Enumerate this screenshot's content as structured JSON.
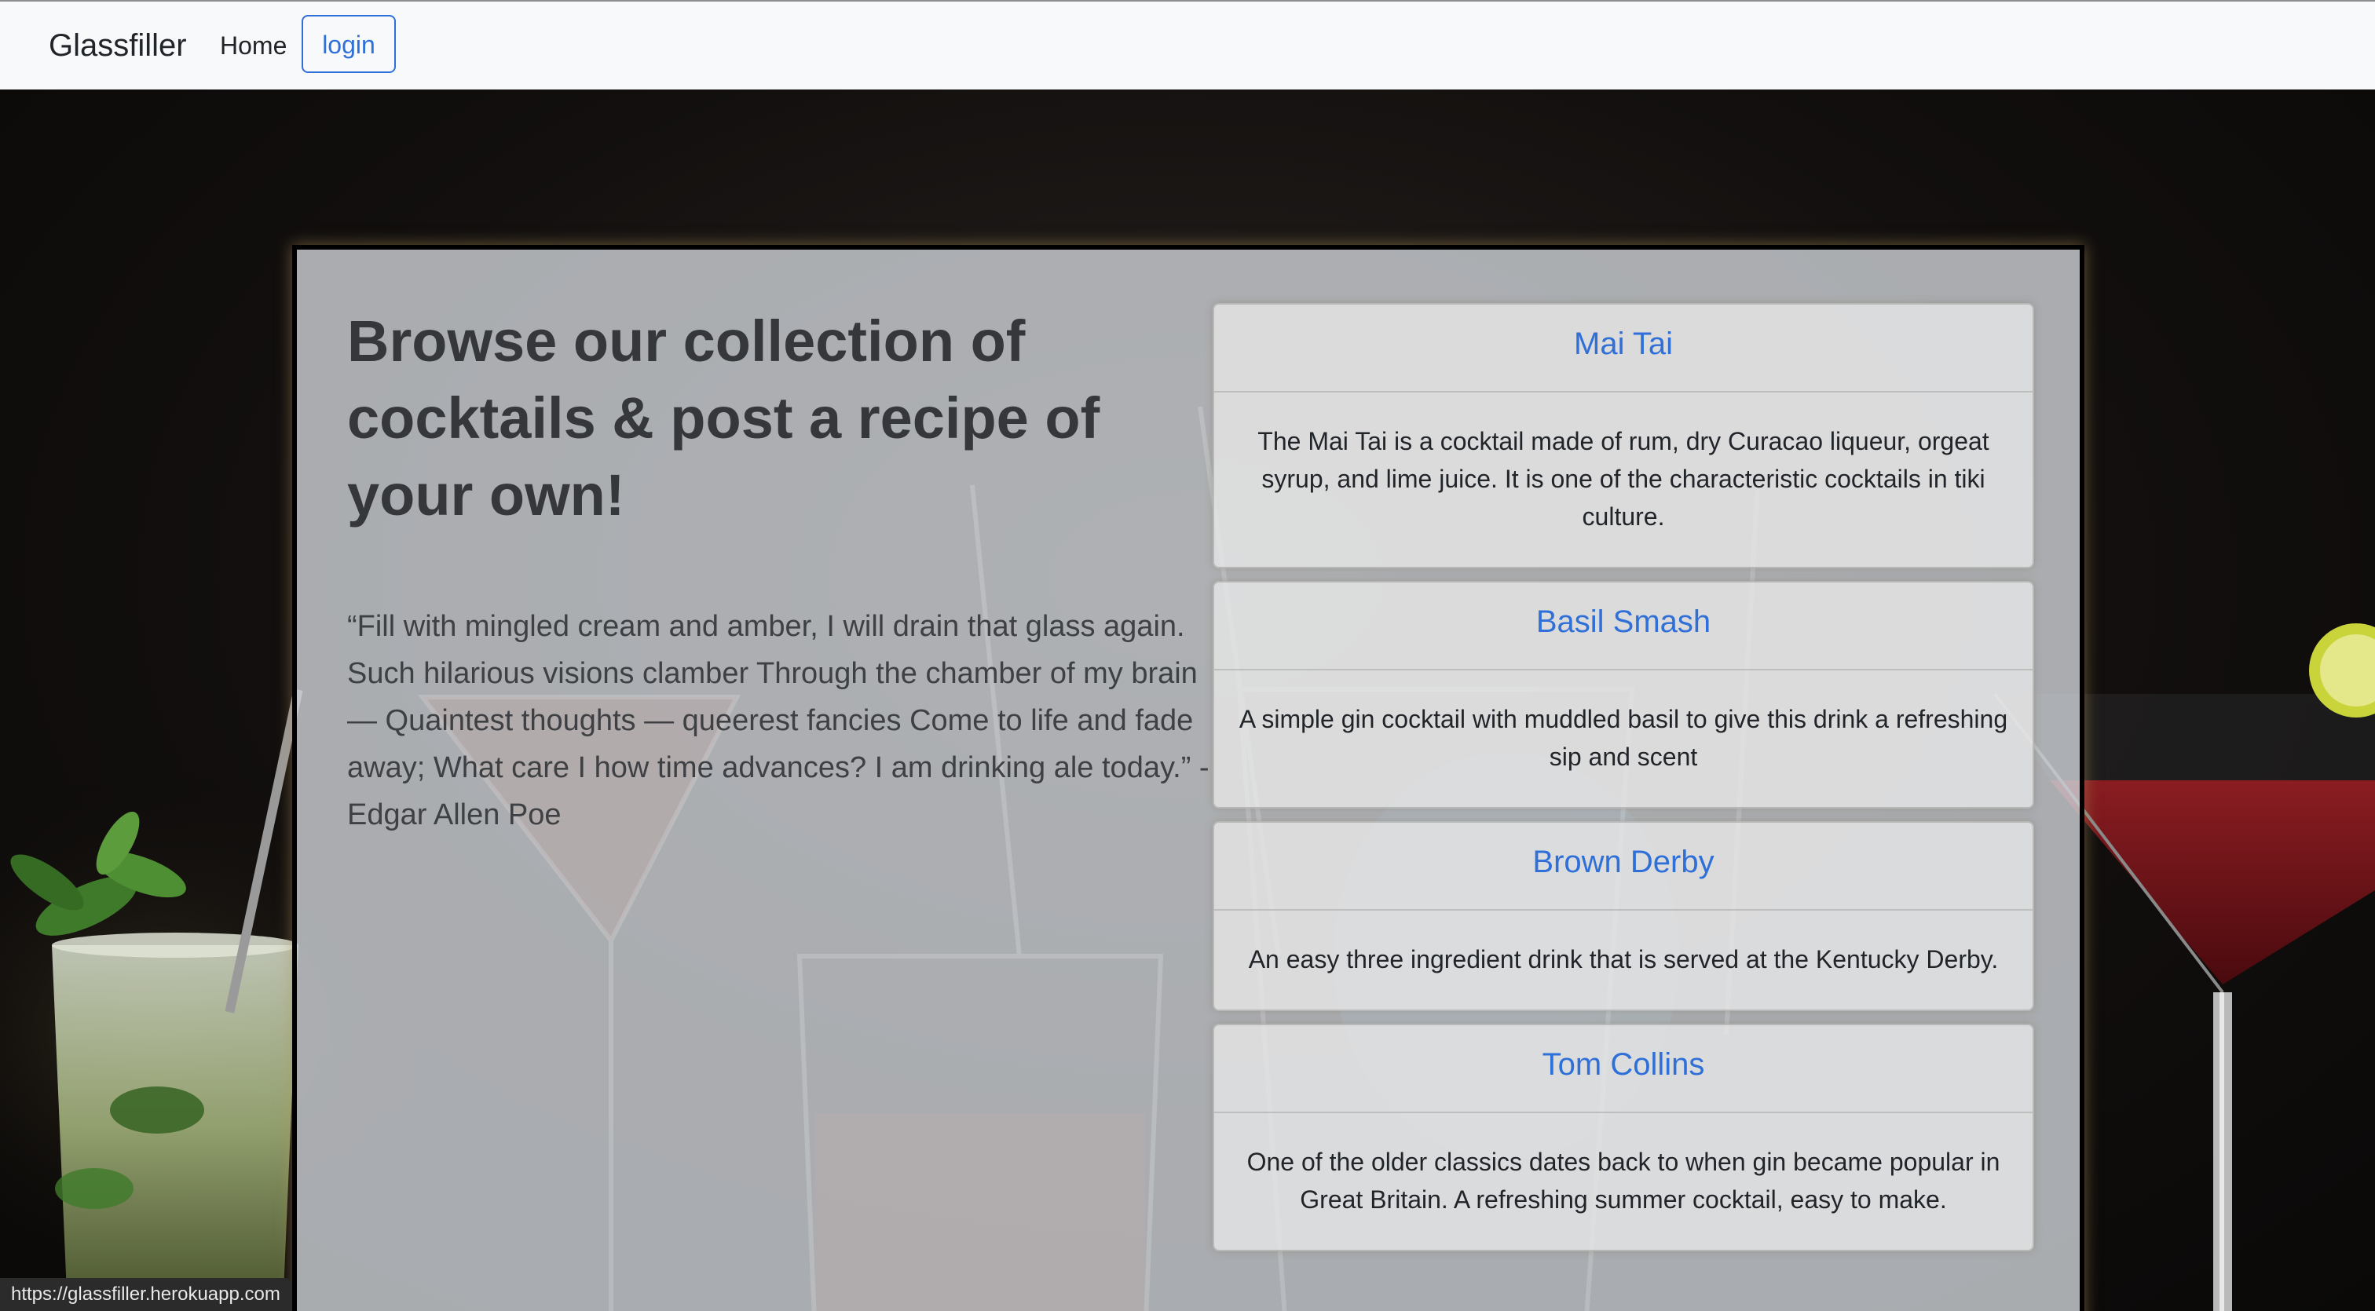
{
  "navbar": {
    "brand": "Glassfiller",
    "home_label": "Home",
    "login_label": "login"
  },
  "hero": {
    "headline": "Browse our collection of cocktails & post a recipe of your own!",
    "quote": "“Fill with mingled cream and amber, I will drain that glass again. Such hilarious visions clamber Through the chamber of my brain — Quaintest thoughts — queerest fancies Come to life and fade away; What care I how time advances? I am drinking ale today.” -Edgar Allen Poe"
  },
  "cocktails": [
    {
      "name": "Mai Tai",
      "description": "The Mai Tai is a cocktail made of rum, dry Curacao liqueur, orgeat syrup, and lime juice. It is one of the characteristic cocktails in tiki culture."
    },
    {
      "name": "Basil Smash",
      "description": "A simple gin cocktail with muddled basil to give this drink a refreshing sip and scent"
    },
    {
      "name": "Brown Derby",
      "description": "An easy three ingredient drink that is served at the Kentucky Derby."
    },
    {
      "name": "Tom Collins",
      "description": "One of the older classics dates back to when gin became popular in Great Britain. A refreshing summer cocktail, easy to make."
    }
  ],
  "status_bar": {
    "url": "https://glassfiller.herokuapp.com"
  },
  "colors": {
    "navbar_bg": "#f8f9fa",
    "link_blue": "#2f6fd8",
    "panel_bg": "#cccfd4",
    "page_bg": "#0d0b0a"
  }
}
